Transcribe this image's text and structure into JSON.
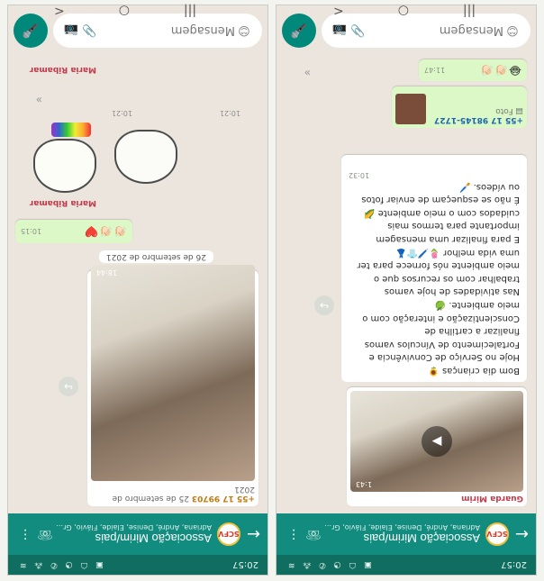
{
  "status": {
    "time": "20:57",
    "icons": "▣ ☖ ◔ ✆ ⁂ ≋"
  },
  "header": {
    "group_name": "Associação Mirim/pais",
    "avatar_text": "SCFV",
    "members_left": "Adriana, André, Denise, Elaide, Flávio, Gra...",
    "members_right": "Adriana, André, Denise, Elaide, Flávio, Gra..."
  },
  "left_chat": {
    "sender": "Guarda Mirim",
    "video_time": "1:43",
    "message_lines": [
      "Bom dia crianças 🌻",
      "Hoje no Serviço de Convivência e",
      "Fortalecimento de Vínculos vamos",
      "finalizar a cartilha de",
      "Conscientização e interação com o",
      "meio ambiente. 🍏",
      "Nas atividades de hoje vamos",
      "trabalhar com os recursos que o",
      "meio ambiente nós fornece para ter",
      "uma vida melhor 🌷🖊️👕👗",
      "E para finalizar uma mensagem",
      "importante para termos mais",
      "cuidados com o meio ambiente 🌽",
      "É não se esqueçam de enviar fotos",
      "ou vídeos. 🖌️"
    ],
    "message_time": "10:32",
    "photo_phone": "+55 17 98145-1727",
    "photo_label": "Foto",
    "emoji_reactions": "😂👏🏻👏🏻",
    "emoji_time": "11:47"
  },
  "right_chat": {
    "date_top": "25 de setembro de 2021",
    "photo_phone": "+55 17 99703",
    "photo_time": "18:44",
    "date_middle": "26 de setembro de 2021",
    "emoji_reactions": "👏🏻👏🏻❤️",
    "emoji_time": "10:15",
    "sender_1": "Maria Ribamar",
    "sticker_time_1": "10:21",
    "sticker_time_2": "10:21",
    "sender_2": "Maria Ribamar"
  },
  "input": {
    "placeholder": "Mensagem",
    "emoji_icon": "😊",
    "attach_icon": "📎",
    "camera_icon": "📷",
    "mic_icon": "🎤"
  },
  "nav": {
    "back": "<",
    "home": "○",
    "recents": "|||"
  },
  "colors": {
    "header": "#128c7e",
    "status": "#0f6e60",
    "accent": "#00897b",
    "own_bubble": "#dcf8c6"
  }
}
